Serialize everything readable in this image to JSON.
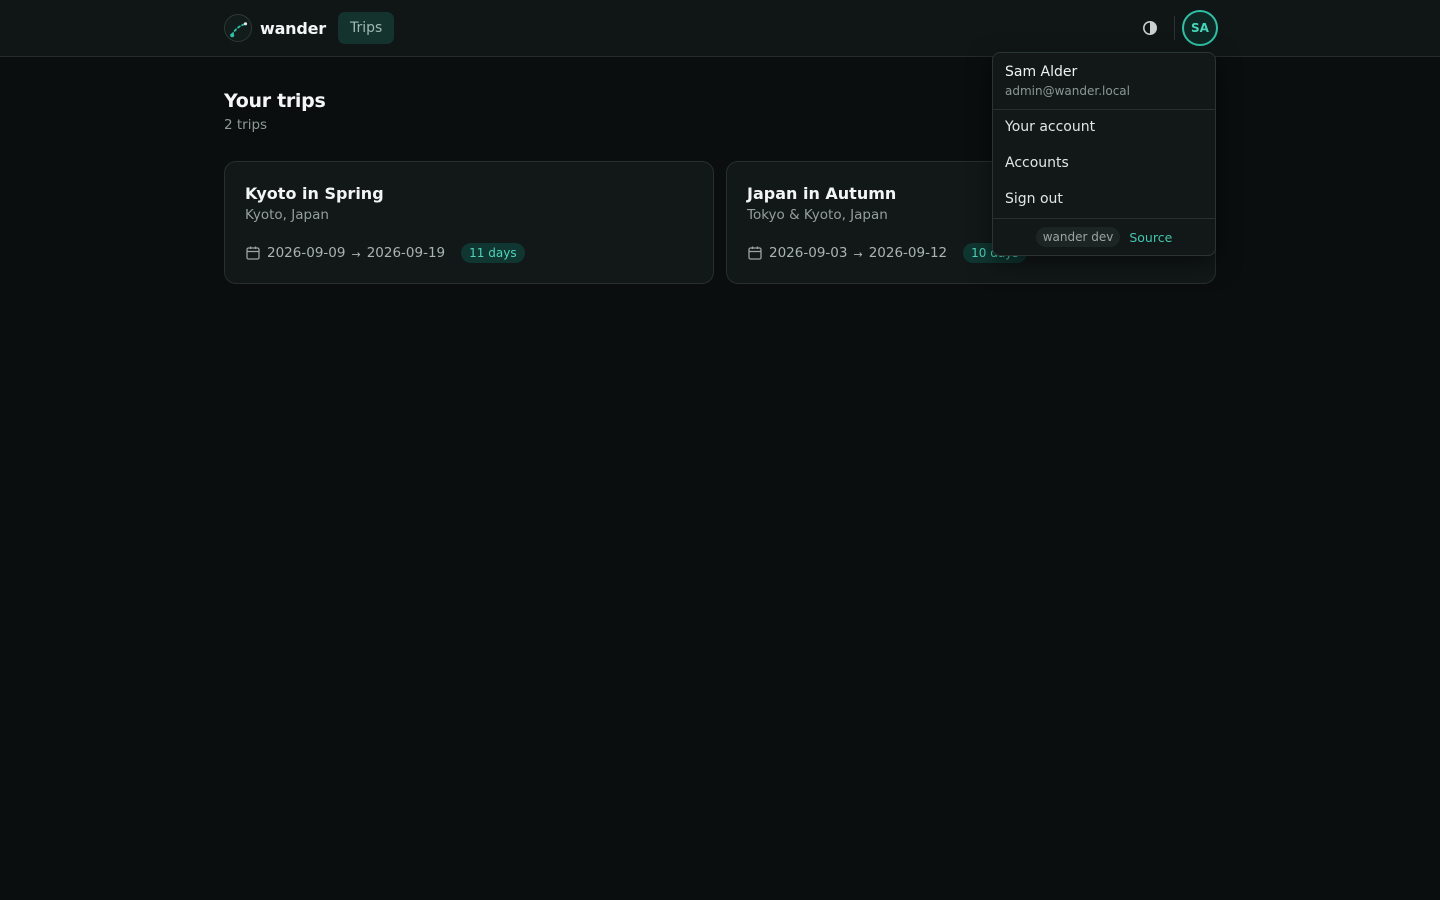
{
  "header": {
    "brand_name": "wander",
    "nav": {
      "trips_label": "Trips"
    },
    "theme_toggle_icon": "contrast-icon",
    "avatar_initials": "SA"
  },
  "colors": {
    "accent": "#2fbfa5",
    "background": "#0a0e0e",
    "card": "#121818"
  },
  "main": {
    "title": "Your trips",
    "subtitle": "2 trips",
    "trips": [
      {
        "title": "Kyoto in Spring",
        "location": "Kyoto, Japan",
        "start_date": "2026-09-09",
        "arrow": "→",
        "end_date": "2026-09-19",
        "duration": "11 days"
      },
      {
        "title": "Japan in Autumn",
        "location": "Tokyo & Kyoto, Japan",
        "start_date": "2026-09-03",
        "arrow": "→",
        "end_date": "2026-09-12",
        "duration": "10 days"
      }
    ]
  },
  "user_menu": {
    "name": "Sam Alder",
    "email": "admin@wander.local",
    "items": [
      "Your account",
      "Accounts",
      "Sign out"
    ],
    "version_chip": "wander dev",
    "source_link": "Source"
  }
}
